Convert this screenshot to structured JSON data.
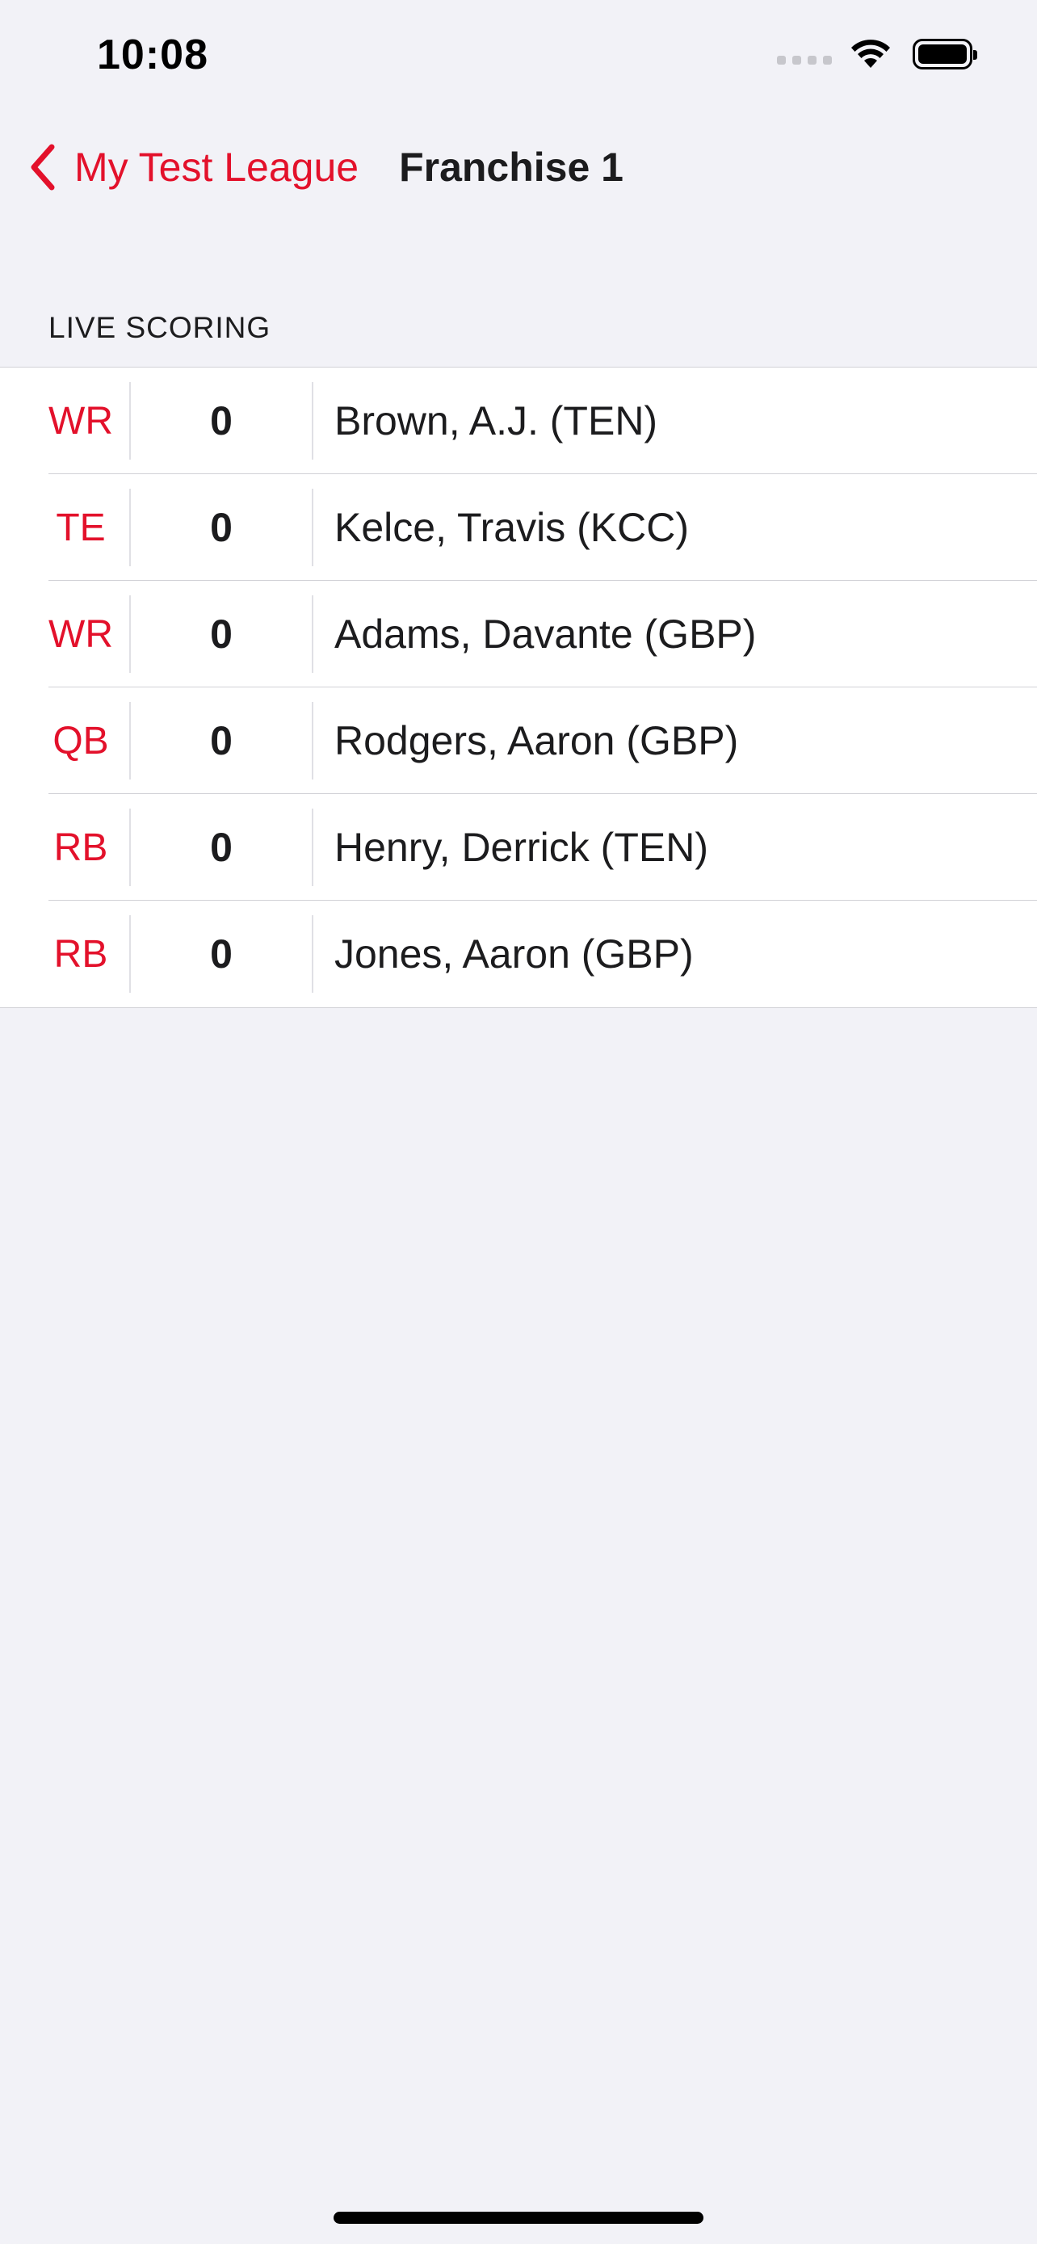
{
  "status_bar": {
    "time": "10:08"
  },
  "nav": {
    "back_label": "My Test League",
    "title": "Franchise 1"
  },
  "section": {
    "header": "LIVE SCORING"
  },
  "rows": [
    {
      "position": "WR",
      "score": "0",
      "player": "Brown, A.J. (TEN)"
    },
    {
      "position": "TE",
      "score": "0",
      "player": "Kelce, Travis (KCC)"
    },
    {
      "position": "WR",
      "score": "0",
      "player": "Adams, Davante (GBP)"
    },
    {
      "position": "QB",
      "score": "0",
      "player": "Rodgers, Aaron (GBP)"
    },
    {
      "position": "RB",
      "score": "0",
      "player": "Henry, Derrick (TEN)"
    },
    {
      "position": "RB",
      "score": "0",
      "player": "Jones, Aaron (GBP)"
    }
  ],
  "colors": {
    "accent": "#e3112b",
    "background": "#f2f2f7",
    "cell": "#ffffff"
  },
  "icons": {
    "back": "chevron-left-icon",
    "wifi": "wifi-icon",
    "battery": "battery-icon",
    "signal": "cellular-signal-icon"
  }
}
